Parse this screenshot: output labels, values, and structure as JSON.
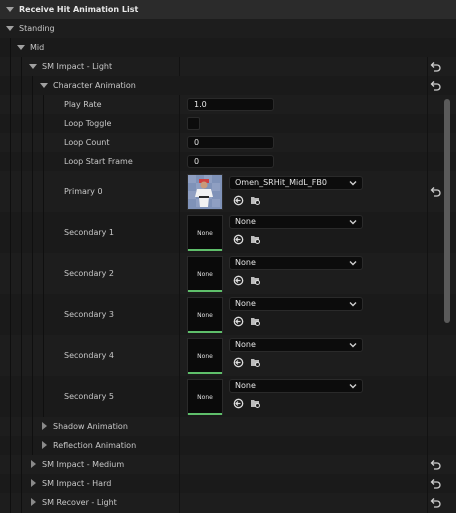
{
  "title": "Receive Hit Animation List",
  "standing": "Standing",
  "mid": "Mid",
  "sm_impact_light": "SM Impact - Light",
  "character_animation": "Character Animation",
  "props": {
    "play_rate": {
      "label": "Play Rate",
      "value": "1.0"
    },
    "loop_toggle": {
      "label": "Loop Toggle"
    },
    "loop_count": {
      "label": "Loop Count",
      "value": "0"
    },
    "loop_start_frame": {
      "label": "Loop Start Frame",
      "value": "0"
    }
  },
  "primary": {
    "label": "Primary 0",
    "asset": "Omen_SRHit_MidL_FB0"
  },
  "secondaries": [
    {
      "label": "Secondary 1",
      "thumb": "None",
      "asset": "None"
    },
    {
      "label": "Secondary 2",
      "thumb": "None",
      "asset": "None"
    },
    {
      "label": "Secondary 3",
      "thumb": "None",
      "asset": "None"
    },
    {
      "label": "Secondary 4",
      "thumb": "None",
      "asset": "None"
    },
    {
      "label": "Secondary 5",
      "thumb": "None",
      "asset": "None"
    }
  ],
  "shadow_animation": "Shadow Animation",
  "reflection_animation": "Reflection Animation",
  "sm_impact_medium": "SM Impact - Medium",
  "sm_impact_hard": "SM Impact - Hard",
  "sm_recover_light": "SM Recover - Light",
  "icons": {
    "reset": "reset-arrow-icon",
    "expand": "triangle-down-icon",
    "collapse": "triangle-right-icon",
    "use": "use-selected-asset-icon",
    "browse": "browse-folder-icon",
    "dropdown": "chevron-down-icon"
  }
}
